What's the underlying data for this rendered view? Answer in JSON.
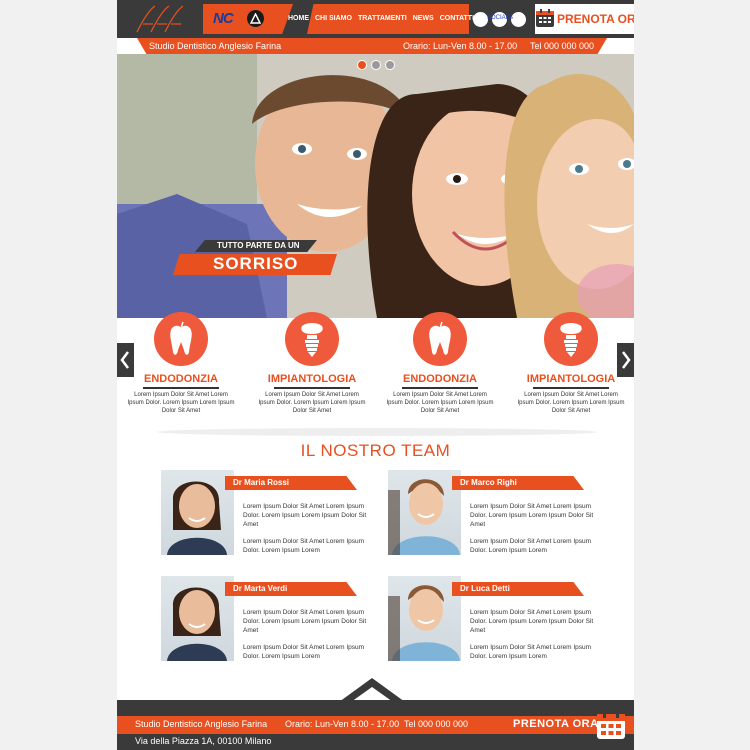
{
  "header": {
    "brand_abbrev": "NC",
    "nav": [
      {
        "label": "HOME",
        "active": true
      },
      {
        "label": "CHI SIAMO",
        "active": false
      },
      {
        "label": "TRATTAMENTI",
        "active": false
      },
      {
        "label": "NEWS",
        "active": false
      },
      {
        "label": "CONTATTI",
        "active": false
      }
    ],
    "social_label": "SOCIALS",
    "book_label": "PRENOTA ORA!"
  },
  "infobar": {
    "studio": "Studio Dentistico Anglesio Farina",
    "hours": "Orario: Lun-Ven 8.00 - 17.00",
    "phone": "Tel 000 000 000"
  },
  "hero": {
    "slider_active": 0,
    "slides": 3,
    "tagline": "TUTTO PARTE DA UN",
    "headline": "SORRISO"
  },
  "services": [
    {
      "title": "ENDODONZIA",
      "icon": "tooth-icon",
      "text": "Lorem Ipsum Dolor Sit Amet Lorem Ipsum Dolor. Lorem Ipsum Lorem Ipsum Dolor Sit Amet"
    },
    {
      "title": "IMPIANTOLOGIA",
      "icon": "implant-icon",
      "text": "Lorem Ipsum Dolor Sit Amet Lorem Ipsum Dolor. Lorem Ipsum Lorem Ipsum Dolor Sit Amet"
    },
    {
      "title": "ENDODONZIA",
      "icon": "tooth-icon",
      "text": "Lorem Ipsum Dolor Sit Amet Lorem Ipsum Dolor. Lorem Ipsum Lorem Ipsum Dolor Sit Amet"
    },
    {
      "title": "IMPIANTOLOGIA",
      "icon": "implant-icon",
      "text": "Lorem Ipsum Dolor Sit Amet Lorem Ipsum Dolor. Lorem Ipsum Lorem Ipsum Dolor Sit Amet"
    }
  ],
  "team": {
    "title": "IL NOSTRO TEAM",
    "members": [
      {
        "name": "Dr Maria Rossi",
        "bio1": "Lorem Ipsum Dolor Sit Amet Lorem Ipsum Dolor. Lorem Ipsum Lorem Ipsum Dolor Sit Amet",
        "bio2": "Lorem Ipsum Dolor Sit Amet Lorem Ipsum Dolor. Lorem Ipsum Lorem"
      },
      {
        "name": "Dr Marco Righi",
        "bio1": "Lorem Ipsum Dolor Sit Amet Lorem Ipsum Dolor. Lorem Ipsum Lorem Ipsum Dolor Sit Amet",
        "bio2": "Lorem Ipsum Dolor Sit Amet Lorem Ipsum Dolor. Lorem Ipsum Lorem"
      },
      {
        "name": "Dr Marta Verdi",
        "bio1": "Lorem Ipsum Dolor Sit Amet Lorem Ipsum Dolor. Lorem Ipsum Lorem Ipsum Dolor Sit Amet",
        "bio2": "Lorem Ipsum Dolor Sit Amet Lorem Ipsum Dolor. Lorem Ipsum Lorem"
      },
      {
        "name": "Dr Luca Detti",
        "bio1": "Lorem Ipsum Dolor Sit Amet Lorem Ipsum Dolor. Lorem Ipsum Lorem Ipsum Dolor Sit Amet",
        "bio2": "Lorem Ipsum Dolor Sit Amet Lorem Ipsum Dolor. Lorem Ipsum Lorem"
      }
    ]
  },
  "footer": {
    "studio": "Studio Dentistico Anglesio Farina",
    "hours": "Orario: Lun-Ven 8.00 - 17.00",
    "phone": "Tel 000 000 000",
    "book_label": "PRENOTA ORA!",
    "address": "Via della Piazza 1A, 00100 Milano"
  },
  "colors": {
    "accent": "#e8501f",
    "dark": "#3a3a3a",
    "icon_circle": "#f05a3c"
  }
}
